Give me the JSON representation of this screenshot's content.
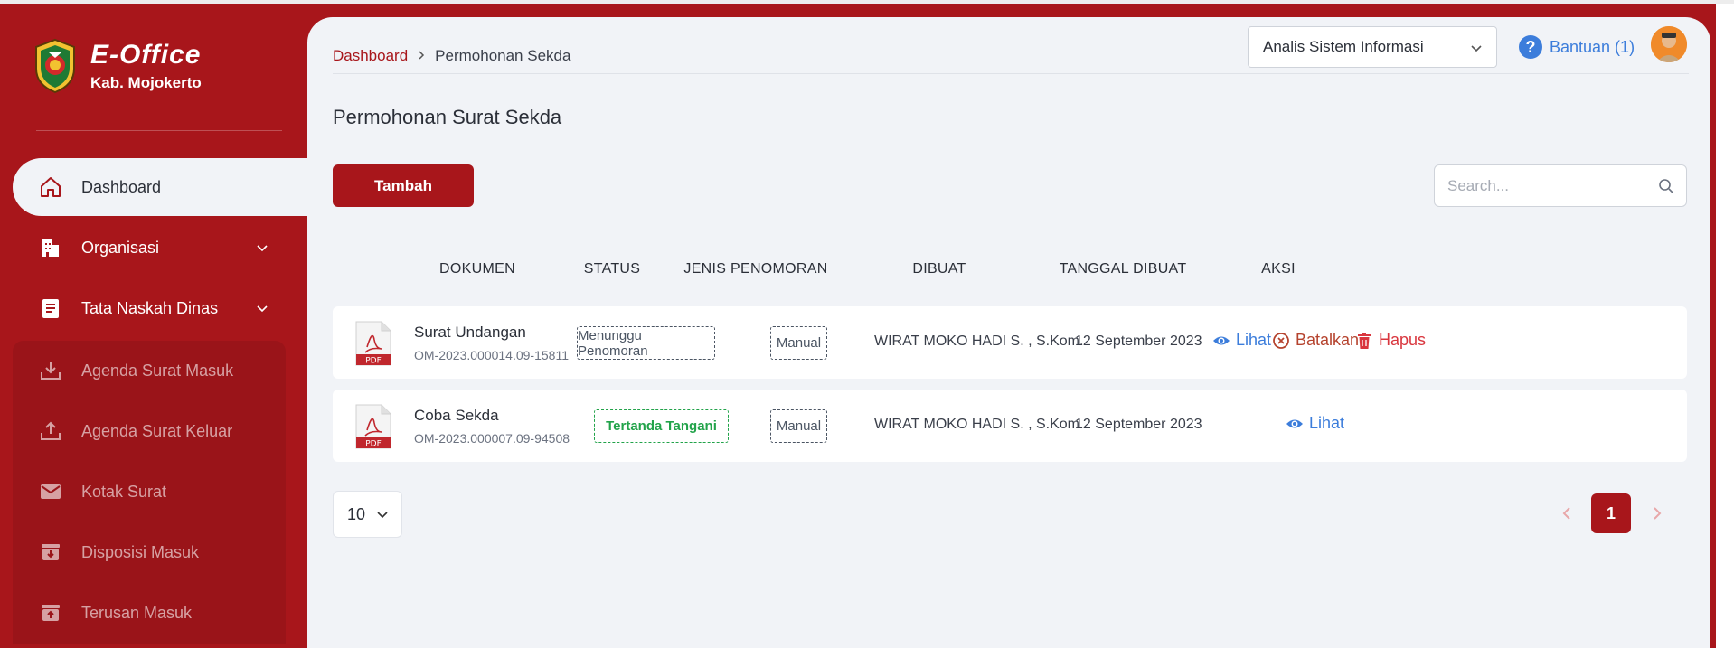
{
  "brand": {
    "title": "E-Office",
    "subtitle": "Kab. Mojokerto"
  },
  "sidebar": {
    "items": [
      {
        "label": "Dashboard",
        "icon": "home-icon",
        "active": true
      },
      {
        "label": "Organisasi",
        "icon": "building-icon",
        "expandable": true
      },
      {
        "label": "Tata Naskah Dinas",
        "icon": "document-icon",
        "expandable": true
      }
    ],
    "submenu": [
      {
        "label": "Agenda Surat Masuk",
        "icon": "download-icon"
      },
      {
        "label": "Agenda Surat Keluar",
        "icon": "upload-icon"
      },
      {
        "label": "Kotak Surat",
        "icon": "mail-icon"
      },
      {
        "label": "Disposisi Masuk",
        "icon": "box-in-icon"
      },
      {
        "label": "Terusan Masuk",
        "icon": "box-up-icon"
      }
    ]
  },
  "breadcrumb": {
    "home": "Dashboard",
    "current": "Permohonan Sekda"
  },
  "header": {
    "role": "Analis Sistem Informasi",
    "help": "Bantuan (1)"
  },
  "page": {
    "title": "Permohonan Surat Sekda",
    "add_label": "Tambah",
    "search_placeholder": "Search..."
  },
  "table": {
    "columns": [
      "DOKUMEN",
      "STATUS",
      "JENIS PENOMORAN",
      "DIBUAT",
      "TANGGAL DIBUAT",
      "AKSI"
    ],
    "rows": [
      {
        "name": "Surat Undangan",
        "code": "OM-2023.000014.09-15811",
        "status": "Menunggu Penomoran",
        "jenis": "Manual",
        "dibuat": "WIRAT MOKO HADI S. , S.Kom.",
        "tanggal": "12 September 2023",
        "actions": {
          "view": "Lihat",
          "cancel": "Batalkan",
          "delete": "Hapus"
        }
      },
      {
        "name": "Coba Sekda",
        "code": "OM-2023.000007.09-94508",
        "status": "Tertanda Tangani",
        "jenis": "Manual",
        "dibuat": "WIRAT MOKO HADI S. , S.Kom.",
        "tanggal": "12 September 2023",
        "actions": {
          "view": "Lihat"
        }
      }
    ]
  },
  "pagination": {
    "per_page": "10",
    "current_page": "1"
  },
  "colors": {
    "primary": "#a8161b",
    "link": "#3c7ddb",
    "success": "#22a34a",
    "background": "#f1f3f7"
  }
}
